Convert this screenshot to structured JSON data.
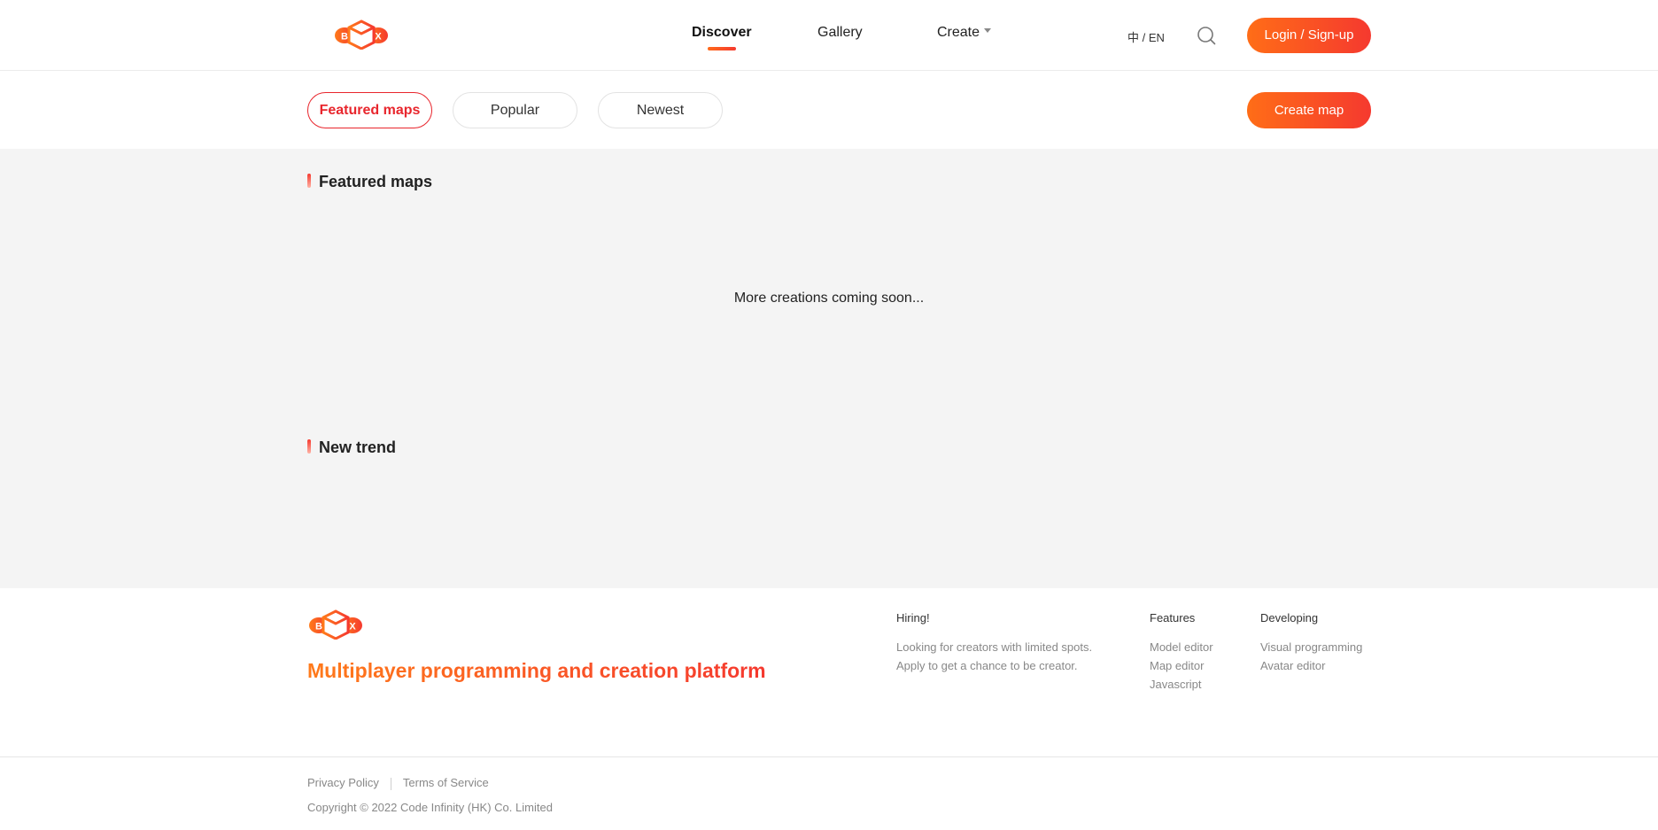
{
  "header": {
    "logo_alt": "BOX",
    "nav": [
      {
        "label": "Discover",
        "active": true
      },
      {
        "label": "Gallery",
        "active": false
      },
      {
        "label": "Create",
        "active": false
      }
    ],
    "language": "中 / EN",
    "login_label": "Login / Sign-up"
  },
  "filters": {
    "tabs": [
      "Featured maps",
      "Popular",
      "Newest"
    ],
    "active_tab": "Featured maps",
    "create_label": "Create map"
  },
  "main": {
    "featured_title": "Featured maps",
    "empty_message": "More creations coming soon...",
    "trend_title": "New trend"
  },
  "footer": {
    "slogan": "Multiplayer programming and creation platform",
    "hiring": {
      "title": "Hiring!",
      "lines": [
        "Looking for creators with limited spots.",
        "Apply to get a chance to be creator."
      ]
    },
    "features": {
      "title": "Features",
      "items": [
        "Model editor",
        "Map editor",
        "Javascript"
      ]
    },
    "developing": {
      "title": "Developing",
      "items": [
        "Visual programming",
        "Avatar editor"
      ]
    },
    "privacy_label": "Privacy Policy",
    "terms_label": "Terms of Service",
    "copyright": "Copyright © 2022 Code Infinity (HK) Co. Limited"
  },
  "theme": {
    "accent_start": "#ff6d17",
    "accent_end": "#f5392f",
    "active_red": "#e8262d",
    "main_bg": "#f4f4f4"
  },
  "icons": [
    "box-logo-icon",
    "search-icon",
    "chevron-down-icon"
  ]
}
